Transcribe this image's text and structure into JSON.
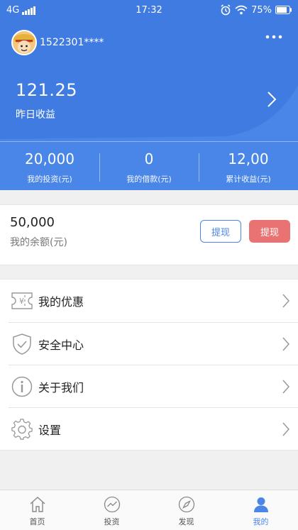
{
  "status_bar": {
    "network": "4G",
    "time": "17:32",
    "battery": "75%"
  },
  "header": {
    "username": "1522301****",
    "yesterday_amount": "121.25",
    "yesterday_label": "昨日收益",
    "accent_color": "#4a86e8"
  },
  "stats": [
    {
      "value": "20,000",
      "label": "我的投资(元)"
    },
    {
      "value": "0",
      "label": "我的借款(元)"
    },
    {
      "value": "12,00",
      "label": "累计收益(元)"
    }
  ],
  "balance": {
    "amount": "50,000",
    "label": "我的余额(元)",
    "button_outline": "提现",
    "button_red": "提现",
    "red_color": "#e97373"
  },
  "menu": [
    {
      "label": "我的优惠",
      "icon": "coupon-icon"
    },
    {
      "label": "安全中心",
      "icon": "shield-check-icon"
    },
    {
      "label": "关于我们",
      "icon": "info-icon"
    },
    {
      "label": "设置",
      "icon": "gear-icon"
    }
  ],
  "tabbar": [
    {
      "label": "首页",
      "icon": "home-icon",
      "active": false
    },
    {
      "label": "投资",
      "icon": "trend-icon",
      "active": false
    },
    {
      "label": "发现",
      "icon": "compass-icon",
      "active": false
    },
    {
      "label": "我的",
      "icon": "user-icon",
      "active": true
    }
  ]
}
